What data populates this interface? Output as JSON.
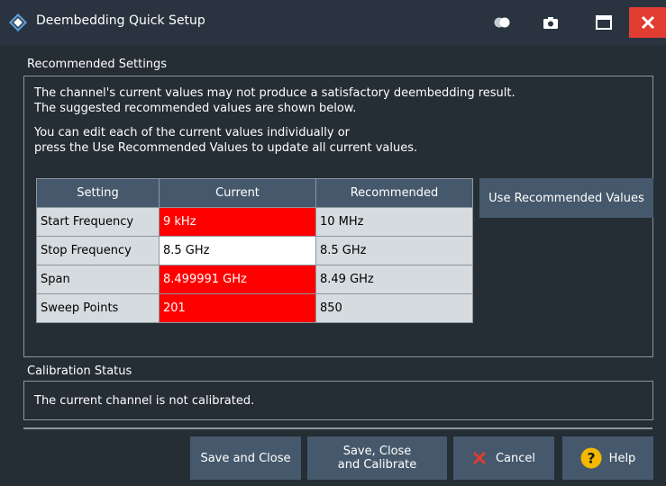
{
  "window": {
    "title": "Deembedding Quick Setup"
  },
  "titlebar_icons": {
    "toggle": "toggle-icon",
    "camera": "camera-icon",
    "maximize": "maximize-icon",
    "close": "close-icon"
  },
  "recommended": {
    "label": "Recommended Settings",
    "line1": "The channel's current values may not produce a satisfactory deembedding result.",
    "line2": "The suggested recommended values are shown below.",
    "line3": "You can edit each of the current values individually or",
    "line4": "press the Use Recommended Values to update all current values.",
    "headers": [
      "Setting",
      "Current",
      "Recommended"
    ],
    "rows": [
      {
        "setting": "Start Frequency",
        "current": "9 kHz",
        "recommended": "10 MHz",
        "mismatch": true
      },
      {
        "setting": "Stop Frequency",
        "current": "8.5 GHz",
        "recommended": "8.5 GHz",
        "mismatch": false
      },
      {
        "setting": "Span",
        "current": "8.499991 GHz",
        "recommended": "8.49 GHz",
        "mismatch": true
      },
      {
        "setting": "Sweep Points",
        "current": "201",
        "recommended": "850",
        "mismatch": true
      }
    ],
    "use_button": "Use Recommended Values"
  },
  "calibration": {
    "label": "Calibration Status",
    "message": "The current channel is not calibrated."
  },
  "buttons": {
    "save_close": "Save and Close",
    "save_calibrate_line1": "Save, Close",
    "save_calibrate_line2": "and Calibrate",
    "cancel": "Cancel",
    "help": "Help"
  },
  "colors": {
    "mismatch": "#ff0000",
    "close_button": "#e03c31",
    "cancel_icon": "#e03c31",
    "help_icon": "#f5b800"
  }
}
